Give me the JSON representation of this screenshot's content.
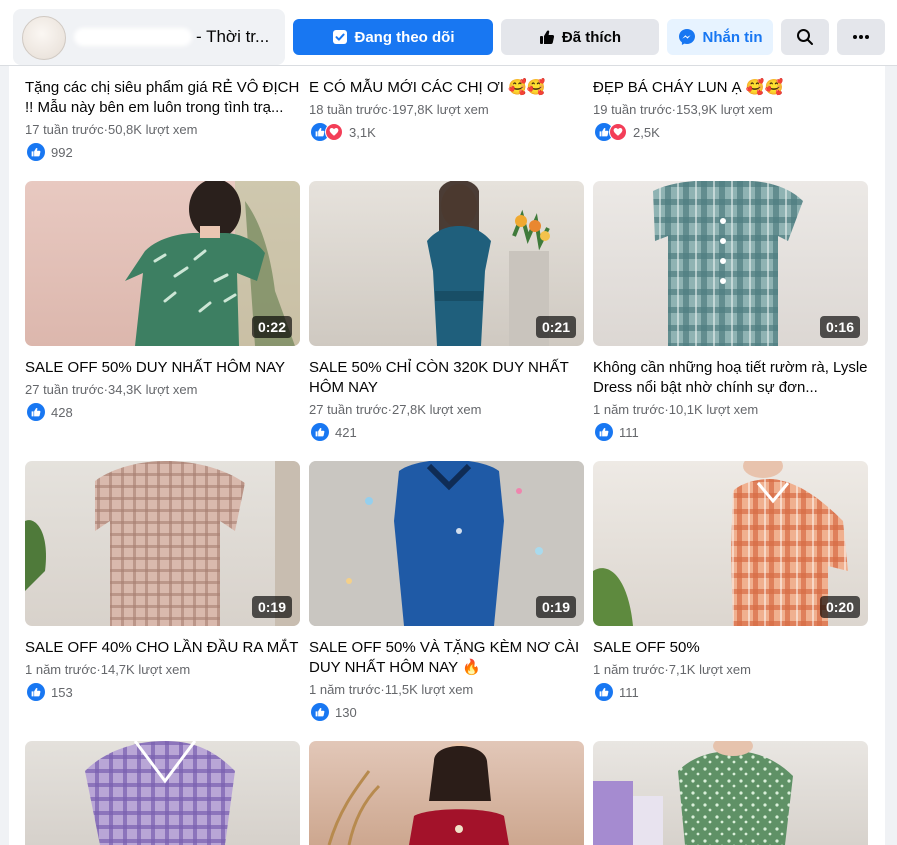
{
  "header": {
    "page_name": "- Thời tr...",
    "following_label": "Đang theo dõi",
    "liked_label": "Đã thích",
    "message_label": "Nhắn tin",
    "accent": "#1877f2"
  },
  "videos": [
    {
      "title": "Tặng các chị siêu phẩm giá RẺ VÔ ĐỊCH !! Mẫu này bên em luôn trong tình trạ...",
      "meta": "17 tuần trước·50,8K lượt xem",
      "reactions": "992",
      "love": false
    },
    {
      "title": "E CÓ MẪU MỚI CÁC CHỊ ƠI 🥰🥰",
      "meta": "18 tuần trước·197,8K lượt xem",
      "reactions": "3,1K",
      "love": true
    },
    {
      "title": "ĐẸP BÁ CHÁY LUN Ạ 🥰🥰",
      "meta": "19 tuần trước·153,9K lượt xem",
      "reactions": "2,5K",
      "love": true
    },
    {
      "title": "SALE OFF 50% DUY NHẤT HÔM NAY",
      "meta": "27 tuần trước·34,3K lượt xem",
      "reactions": "428",
      "duration": "0:22",
      "love": false
    },
    {
      "title": "SALE 50% CHỈ CÒN 320K DUY NHẤT HÔM NAY",
      "meta": "27 tuần trước·27,8K lượt xem",
      "reactions": "421",
      "duration": "0:21",
      "love": false
    },
    {
      "title": "Không cần những hoạ tiết rườm rà, Lysle Dress nổi bật nhờ chính sự đơn...",
      "meta": "1 năm trước·10,1K lượt xem",
      "reactions": "111",
      "duration": "0:16",
      "love": false
    },
    {
      "title": "SALE OFF 40% CHO LẦN ĐẦU RA MẮT",
      "meta": "1 năm trước·14,7K lượt xem",
      "reactions": "153",
      "duration": "0:19",
      "love": false
    },
    {
      "title": "SALE OFF 50% VÀ TẶNG KÈM NƠ CÀI DUY NHẤT HÔM NAY 🔥",
      "meta": "1 năm trước·11,5K lượt xem",
      "reactions": "130",
      "duration": "0:19",
      "love": false
    },
    {
      "title": "SALE OFF 50%",
      "meta": "1 năm trước·7,1K lượt xem",
      "reactions": "111",
      "duration": "0:20",
      "love": false
    }
  ]
}
